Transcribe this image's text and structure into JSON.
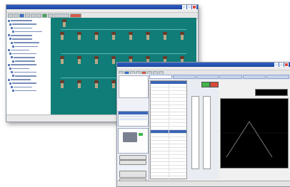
{
  "back_window": {
    "title": "",
    "menu": [
      "",
      "",
      "",
      "",
      "",
      "",
      ""
    ],
    "device_rows": 3,
    "device_cols": 8
  },
  "front_window": {
    "title": "",
    "menu": [
      "",
      "",
      "",
      "",
      "",
      "",
      "",
      "",
      ""
    ],
    "graph": {
      "type": "line",
      "shape": "triangle",
      "line_color": "#7a7a7a",
      "background": "#000000"
    }
  },
  "colors": {
    "canvas": "#117d78",
    "accent": "#3a64b5",
    "indicator_green": "#3fb54a",
    "indicator_red": "#d64a3a"
  }
}
